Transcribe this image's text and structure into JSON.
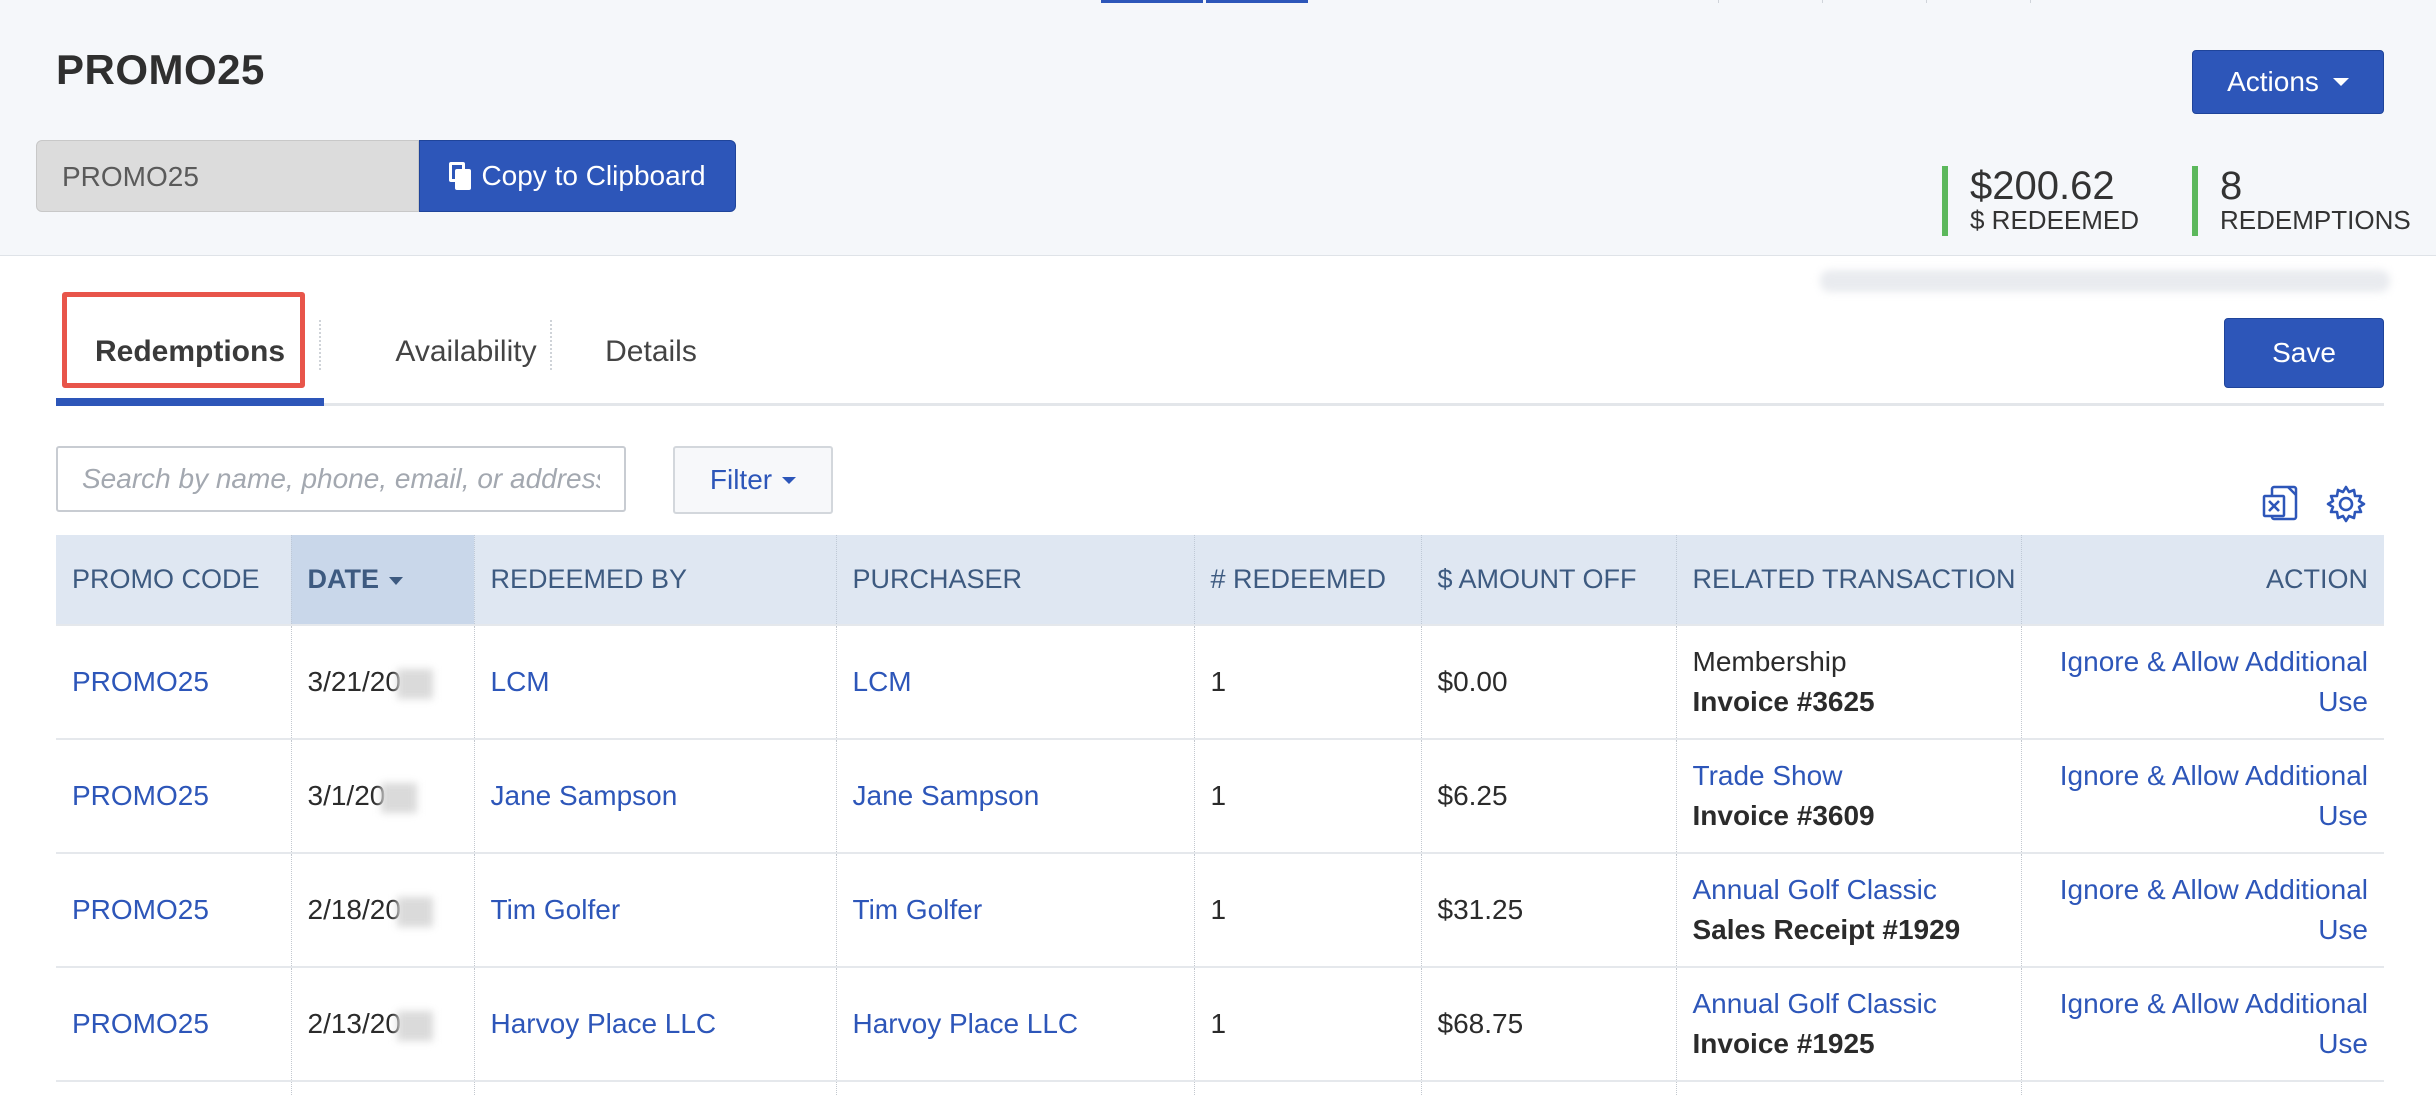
{
  "header": {
    "title": "PROMO25",
    "code_value": "PROMO25",
    "copy_label": "Copy to Clipboard",
    "actions_label": "Actions",
    "stats": [
      {
        "value": "$200.62",
        "label": "$ REDEEMED"
      },
      {
        "value": "8",
        "label": "REDEMPTIONS"
      }
    ]
  },
  "tabs": [
    {
      "label": "Redemptions",
      "active": true
    },
    {
      "label": "Availability",
      "active": false
    },
    {
      "label": "Details",
      "active": false
    }
  ],
  "save_label": "Save",
  "search": {
    "placeholder": "Search by name, phone, email, or address"
  },
  "filter_label": "Filter",
  "icons": {
    "export": "excel-export-icon",
    "settings": "gear-icon"
  },
  "colors": {
    "primary": "#2d56b9",
    "stat_bar": "#5cb85c",
    "highlight": "#e8554a",
    "header_row": "#dfe7f2"
  },
  "table": {
    "columns": [
      "PROMO CODE",
      "DATE",
      "REDEEMED BY",
      "PURCHASER",
      "# REDEEMED",
      "$ AMOUNT OFF",
      "RELATED TRANSACTION",
      "ACTION"
    ],
    "sorted_column": "DATE",
    "rows": [
      {
        "promo": "PROMO25",
        "date": "3/21/20",
        "redeemed_by": "LCM",
        "purchaser": "LCM",
        "count": "1",
        "amount": "$0.00",
        "txn_name": "Membership",
        "txn_name_link": false,
        "txn_ref": "Invoice #3625",
        "action": "Ignore & Allow Additional Use"
      },
      {
        "promo": "PROMO25",
        "date": "3/1/20",
        "redeemed_by": "Jane Sampson",
        "purchaser": "Jane Sampson",
        "count": "1",
        "amount": "$6.25",
        "txn_name": "Trade Show",
        "txn_name_link": true,
        "txn_ref": "Invoice #3609",
        "action": "Ignore & Allow Additional Use"
      },
      {
        "promo": "PROMO25",
        "date": "2/18/20",
        "redeemed_by": "Tim Golfer",
        "purchaser": "Tim Golfer",
        "count": "1",
        "amount": "$31.25",
        "txn_name": "Annual Golf Classic",
        "txn_name_link": true,
        "txn_ref": "Sales Receipt #1929",
        "action": "Ignore & Allow Additional Use"
      },
      {
        "promo": "PROMO25",
        "date": "2/13/20",
        "redeemed_by": "Harvoy Place LLC",
        "purchaser": "Harvoy Place LLC",
        "count": "1",
        "amount": "$68.75",
        "txn_name": "Annual Golf Classic",
        "txn_name_link": true,
        "txn_ref": "Invoice #1925",
        "action": "Ignore & Allow Additional Use"
      }
    ]
  }
}
